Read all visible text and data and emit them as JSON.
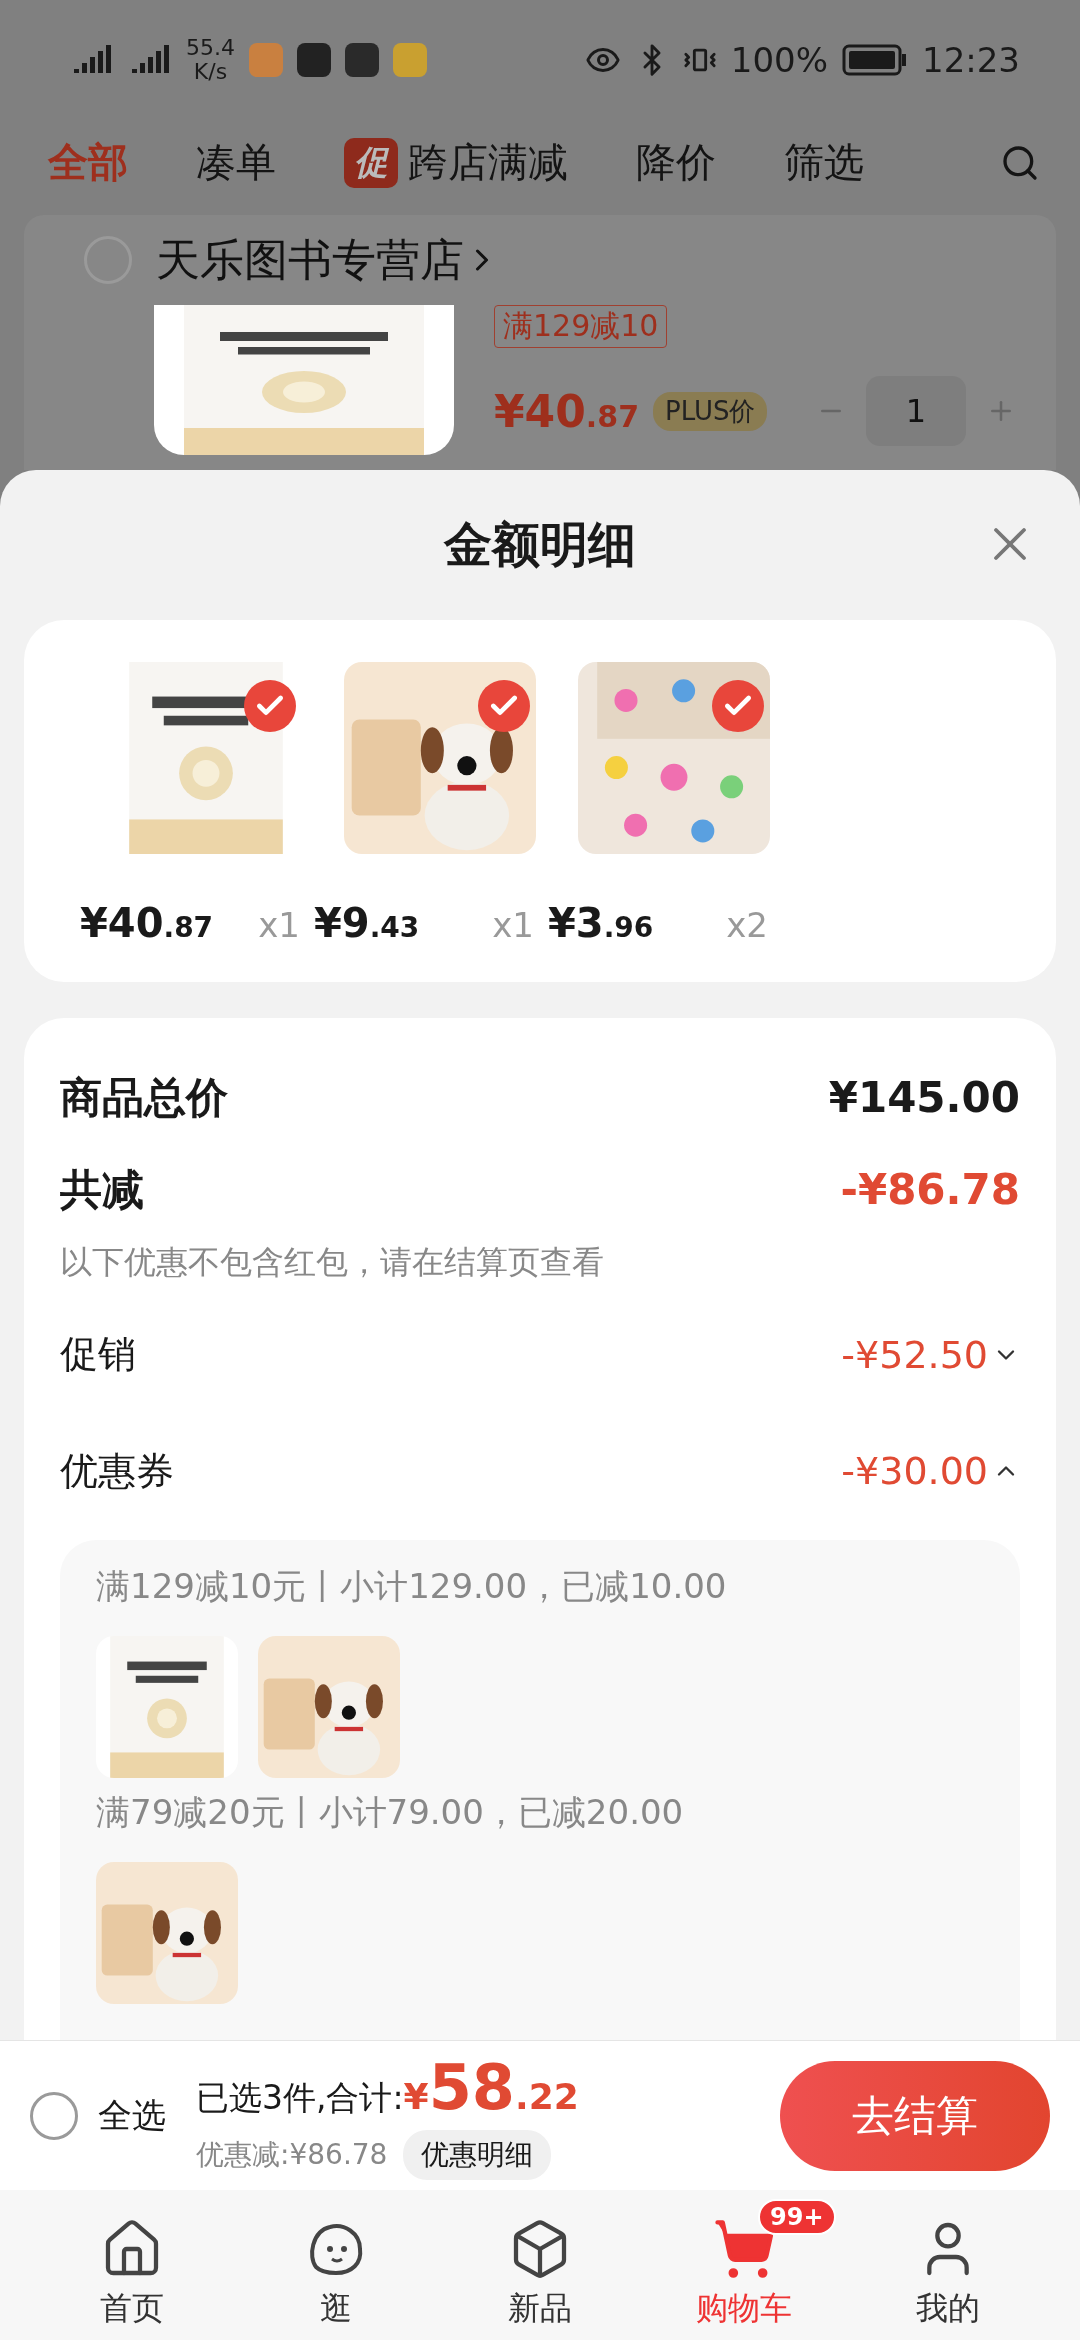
{
  "status_bar": {
    "speed": [
      "55.4",
      "K/s"
    ],
    "battery": "100%",
    "time": "12:23"
  },
  "top_tabs": [
    {
      "label": "全部",
      "selected": true
    },
    {
      "label": "凑单",
      "selected": false
    },
    {
      "label": "跨店满减",
      "selected": false,
      "badge": "促"
    },
    {
      "label": "降价",
      "selected": false
    },
    {
      "label": "筛选",
      "selected": false
    }
  ],
  "store": {
    "name": "天乐图书专营店",
    "checked": false,
    "promo_tag": "满129减10",
    "price_main": "¥40",
    "price_decimal": ".87",
    "plus_tag": "PLUS价",
    "quantity": "1"
  },
  "sheet": {
    "title": "金额明细",
    "items": [
      {
        "checked": true,
        "price_main": "¥40",
        "price_decimal": ".87",
        "quantity": "x1"
      },
      {
        "checked": true,
        "price_main": "¥9",
        "price_decimal": ".43",
        "quantity": "x1"
      },
      {
        "checked": true,
        "price_main": "¥3",
        "price_decimal": ".96",
        "quantity": "x2"
      }
    ],
    "summary": {
      "total_label": "商品总价",
      "total_value": "¥145.00",
      "discount_label": "共减",
      "discount_value": "-¥86.78",
      "note": "以下优惠不包含红包，请在结算页查看",
      "rows": [
        {
          "label": "促销",
          "value": "-¥52.50",
          "expanded": false
        },
        {
          "label": "优惠券",
          "value": "-¥30.00",
          "expanded": true
        }
      ]
    },
    "coupon_groups": [
      {
        "text": "满129减10元丨小计129.00，已减10.00"
      },
      {
        "text": "满79减20元丨小计79.00，已减20.00"
      }
    ]
  },
  "bottom_bar": {
    "select_all": {
      "label": "全选",
      "checked": false
    },
    "selected_text": "已选3件,合计:",
    "currency": "¥",
    "total_main": "58",
    "total_decimal": ".22",
    "savings": "优惠减:¥86.78",
    "detail_button": "优惠明细",
    "checkout": "去结算"
  },
  "nav": [
    {
      "label": "首页",
      "selected": false
    },
    {
      "label": "逛",
      "selected": false
    },
    {
      "label": "新品",
      "selected": false
    },
    {
      "label": "购物车",
      "selected": true,
      "badge": "99+"
    },
    {
      "label": "我的",
      "selected": false
    }
  ]
}
